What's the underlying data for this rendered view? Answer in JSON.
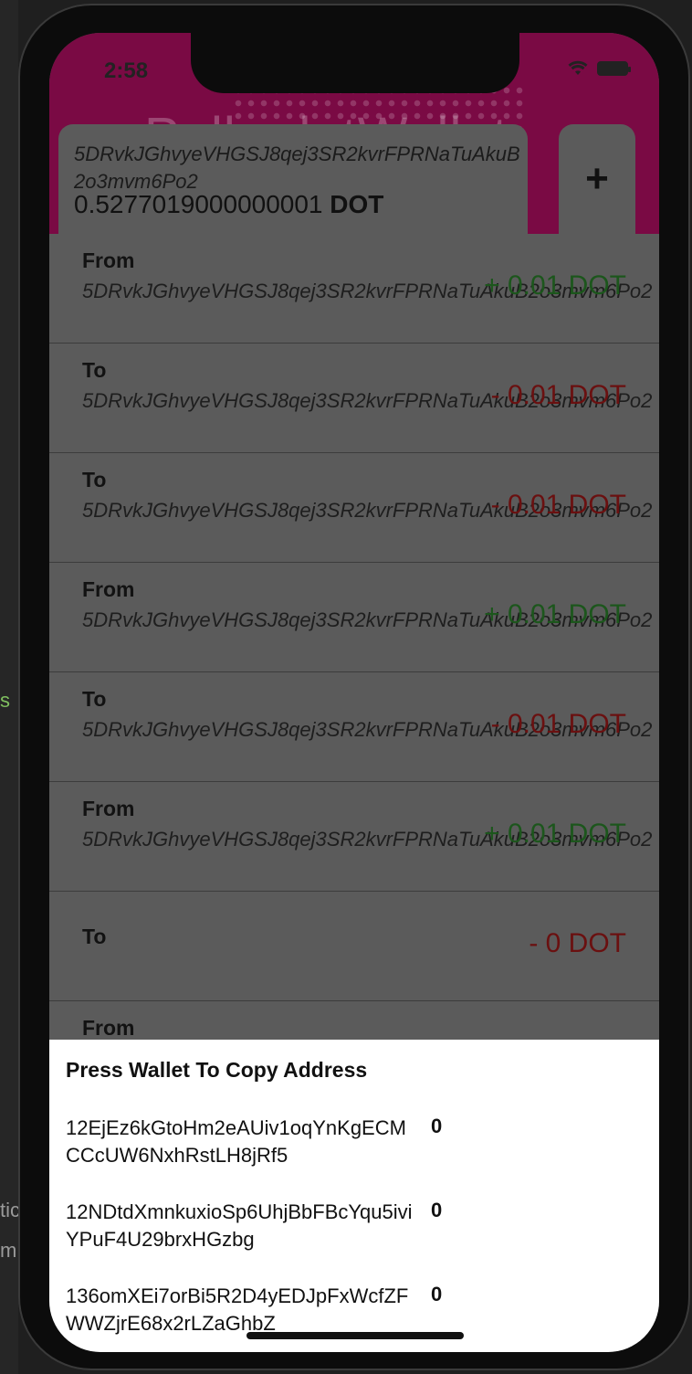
{
  "status_bar": {
    "time": "2:58"
  },
  "header": {
    "background_title": "PolkadotWallet",
    "add_button_label": "+"
  },
  "wallet_card": {
    "address": "5DRvkJGhvyeVHGSJ8qej3SR2kvrFPRNaTuAkuB2o3mvm6Po2",
    "balance_value": "0.5277019000000001",
    "balance_unit": "DOT"
  },
  "transactions": [
    {
      "direction": "From",
      "address": "5DRvkJGhvyeVHGSJ8qej3SR2kvrFPRNaTuAkuB2o3mvm6Po2",
      "amount": "+ 0.01 DOT",
      "sign": "positive"
    },
    {
      "direction": "To",
      "address": "5DRvkJGhvyeVHGSJ8qej3SR2kvrFPRNaTuAkuB2o3mvm6Po2",
      "amount": "- 0.01 DOT",
      "sign": "negative"
    },
    {
      "direction": "To",
      "address": "5DRvkJGhvyeVHGSJ8qej3SR2kvrFPRNaTuAkuB2o3mvm6Po2",
      "amount": "- 0.01 DOT",
      "sign": "negative"
    },
    {
      "direction": "From",
      "address": "5DRvkJGhvyeVHGSJ8qej3SR2kvrFPRNaTuAkuB2o3mvm6Po2",
      "amount": "+ 0.01 DOT",
      "sign": "positive"
    },
    {
      "direction": "To",
      "address": "5DRvkJGhvyeVHGSJ8qej3SR2kvrFPRNaTuAkuB2o3mvm6Po2",
      "amount": "- 0.01 DOT",
      "sign": "negative"
    },
    {
      "direction": "From",
      "address": "5DRvkJGhvyeVHGSJ8qej3SR2kvrFPRNaTuAkuB2o3mvm6Po2",
      "amount": "+ 0.01 DOT",
      "sign": "positive"
    },
    {
      "direction": "To",
      "address": "",
      "amount": "- 0 DOT",
      "sign": "negative"
    },
    {
      "direction": "From",
      "address": "",
      "amount": "",
      "sign": "positive"
    }
  ],
  "wallet_sheet": {
    "title": "Press Wallet To Copy Address",
    "wallets": [
      {
        "address": "12EjEz6kGtoHm2eAUiv1oqYnKgECMCCcUW6NxhRstLH8jRf5",
        "balance": "0"
      },
      {
        "address": "12NDtdXmnkuxioSp6UhjBbFBcYqu5iviYPuF4U29brxHGzbg",
        "balance": "0"
      },
      {
        "address": "136omXEi7orBi5R2D4yEDJpFxWcfZFWWZjrE68x2rLZaGhbZ",
        "balance": "0"
      }
    ]
  },
  "background_window": {
    "side_text_1": "s",
    "side_text_2": "tic",
    "side_text_3": "m"
  },
  "colors": {
    "header": "#7a0a44",
    "positive_amount": "#1c561c",
    "negative_amount": "#6a1010"
  }
}
